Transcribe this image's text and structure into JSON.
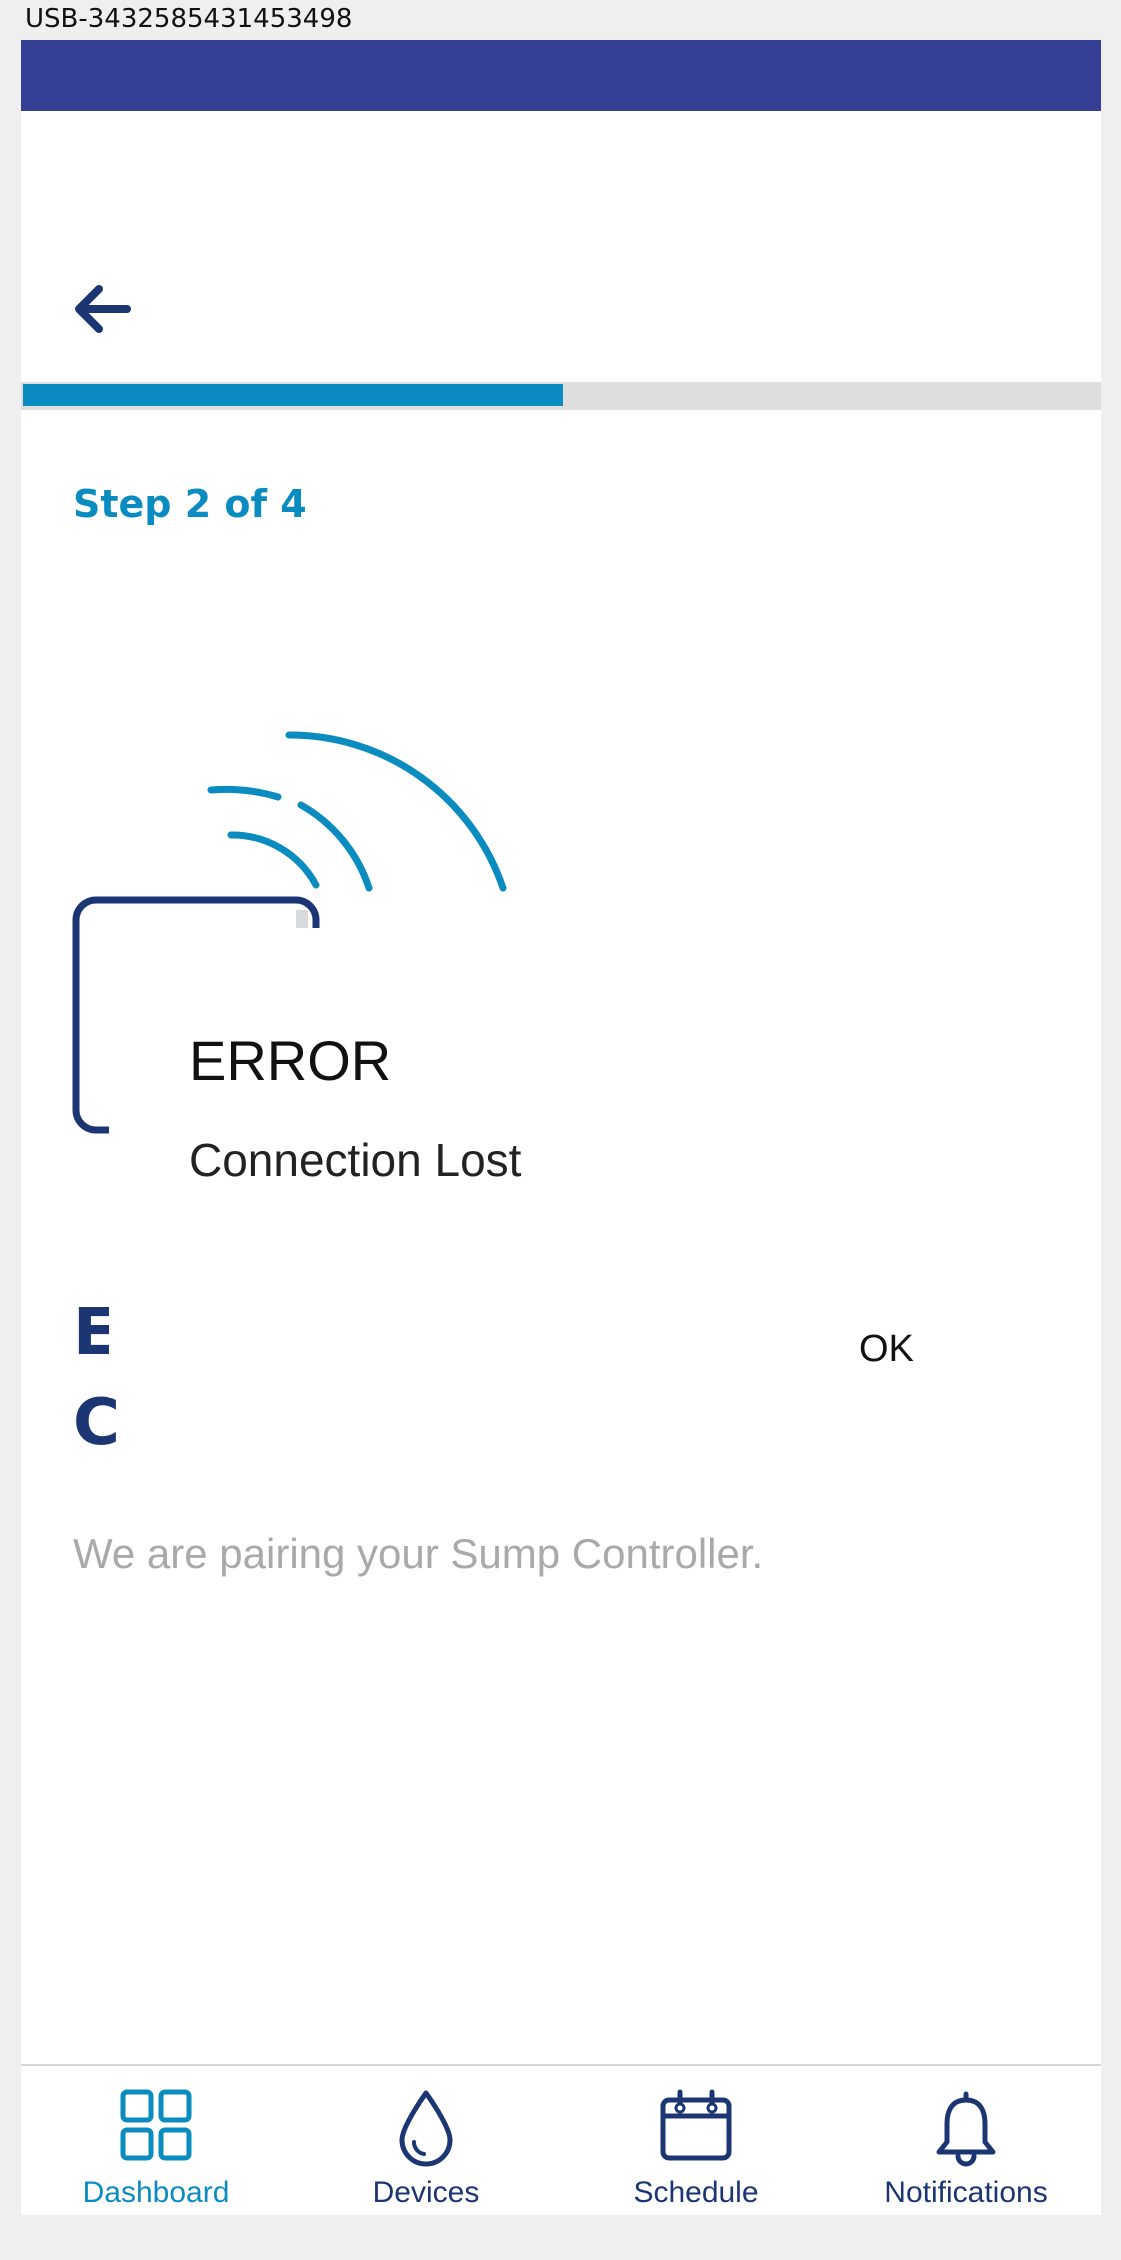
{
  "device_label": "USB-3432585431453498",
  "header": {
    "back_icon": "arrow-left-icon"
  },
  "progress": {
    "current_step": 2,
    "total_steps": 4,
    "fraction": 0.5
  },
  "step_label": "Step 2 of 4",
  "illustration": {
    "icon": "wireless-signal-device-icon"
  },
  "main": {
    "subtitle": "We are pairing your Sump Controller."
  },
  "dialog": {
    "title": "ERROR",
    "message": "Connection Lost",
    "ok_label": "OK"
  },
  "tabbar": {
    "items": [
      {
        "label": "Dashboard",
        "icon": "grid-icon",
        "active": true
      },
      {
        "label": "Devices",
        "icon": "droplet-icon",
        "active": false
      },
      {
        "label": "Schedule",
        "icon": "calendar-icon",
        "active": false
      },
      {
        "label": "Notifications",
        "icon": "bell-icon",
        "active": false
      }
    ]
  },
  "colors": {
    "status_bar": "#353f93",
    "accent": "#0a8cc0",
    "navy": "#1b3673",
    "subtitle_gray": "#a9a9a9"
  }
}
